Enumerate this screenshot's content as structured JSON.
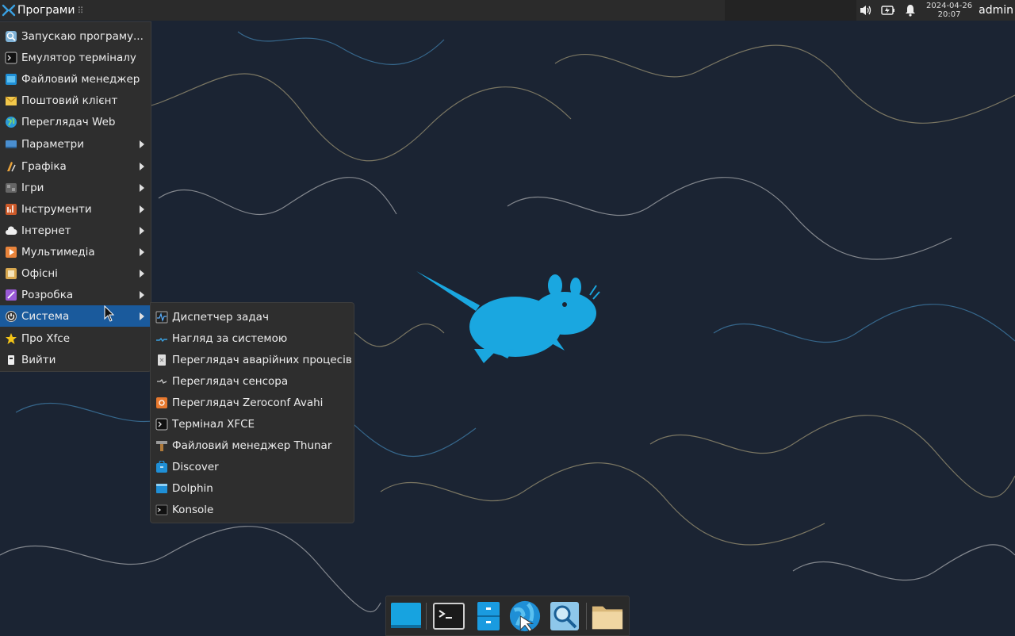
{
  "panel": {
    "apps_label": "Програми",
    "date": "2024-04-26",
    "time": "20:07",
    "user": "admin"
  },
  "menu": {
    "items": [
      {
        "label": "Запускаю програму...",
        "icon": "launcher-search-icon",
        "submenu": false
      },
      {
        "label": "Емулятор терміналу",
        "icon": "terminal-icon",
        "submenu": false
      },
      {
        "label": "Файловий менеджер",
        "icon": "file-manager-icon",
        "submenu": false
      },
      {
        "label": "Поштовий клієнт",
        "icon": "mail-icon",
        "submenu": false
      },
      {
        "label": "Переглядач Web",
        "icon": "web-browser-icon",
        "submenu": false
      },
      {
        "label": "Параметри",
        "icon": "settings-icon",
        "submenu": true
      },
      {
        "label": "Графіка",
        "icon": "graphics-icon",
        "submenu": true
      },
      {
        "label": "Ігри",
        "icon": "games-icon",
        "submenu": true
      },
      {
        "label": "Інструменти",
        "icon": "tools-icon",
        "submenu": true
      },
      {
        "label": "Інтернет",
        "icon": "internet-icon",
        "submenu": true
      },
      {
        "label": "Мультимедіа",
        "icon": "multimedia-icon",
        "submenu": true
      },
      {
        "label": "Офісні",
        "icon": "office-icon",
        "submenu": true
      },
      {
        "label": "Розробка",
        "icon": "development-icon",
        "submenu": true
      },
      {
        "label": "Система",
        "icon": "system-icon",
        "submenu": true,
        "active": true
      },
      {
        "label": "Про Xfce",
        "icon": "star-icon",
        "submenu": false
      },
      {
        "label": "Вийти",
        "icon": "logout-icon",
        "submenu": false
      }
    ]
  },
  "submenu": {
    "items": [
      {
        "label": "Диспетчер задач",
        "icon": "task-manager-icon"
      },
      {
        "label": "Нагляд за системою",
        "icon": "system-monitor-icon"
      },
      {
        "label": "Переглядач аварійних процесів",
        "icon": "crash-viewer-icon"
      },
      {
        "label": "Переглядач сенсора",
        "icon": "sensor-viewer-icon"
      },
      {
        "label": "Переглядач Zeroconf Avahi",
        "icon": "avahi-icon"
      },
      {
        "label": "Термінал XFCE",
        "icon": "terminal-icon"
      },
      {
        "label": "Файловий менеджер Thunar",
        "icon": "thunar-icon"
      },
      {
        "label": "Discover",
        "icon": "discover-icon"
      },
      {
        "label": "Dolphin",
        "icon": "dolphin-icon"
      },
      {
        "label": "Konsole",
        "icon": "konsole-icon"
      }
    ]
  },
  "dock": {
    "items": [
      "desktop-icon",
      "terminal-icon",
      "file-manager-icon",
      "web-browser-icon",
      "app-finder-icon",
      "folder-icon"
    ]
  },
  "colors": {
    "accent": "#1a5a9c",
    "mouse_logo": "#1aa7e0",
    "panel_bg": "#2b2b2b",
    "menu_bg": "#2e2e2e"
  }
}
